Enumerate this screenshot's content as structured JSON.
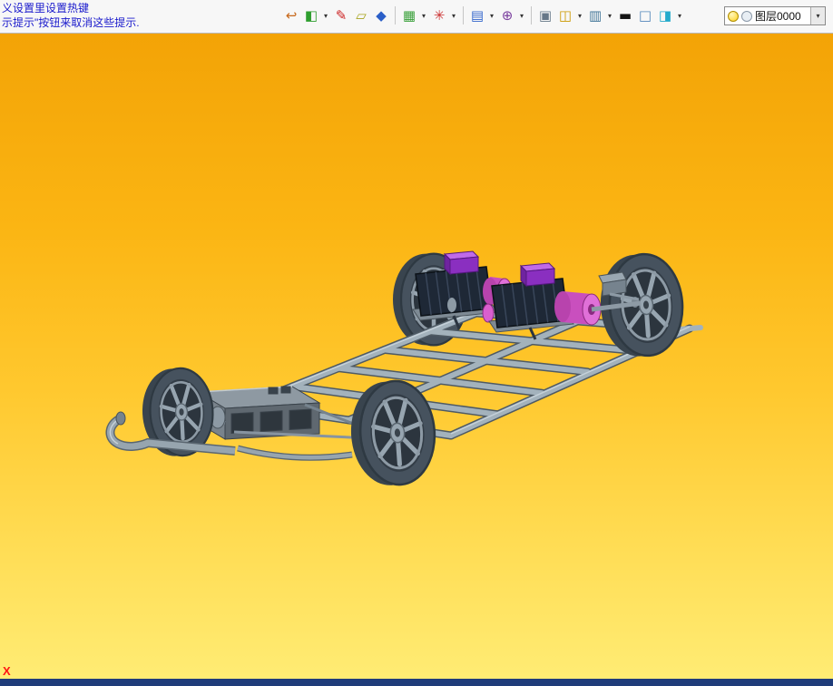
{
  "messages": {
    "line1": "义设置里设置热键",
    "line2": "示提示\"按钮来取消这些提示."
  },
  "toolbar": {
    "dropdown_glyph": "▾",
    "icons": [
      {
        "name": "exit-sketch-icon",
        "glyph": "↩",
        "color": "#C86A1E",
        "dropdown": false
      },
      {
        "name": "fill-style-icon",
        "glyph": "◧",
        "color": "#2E9E2E",
        "dropdown": true
      },
      {
        "name": "sketch-pen-icon",
        "glyph": "✎",
        "color": "#CC2222",
        "dropdown": false
      },
      {
        "name": "plane-sketch-icon",
        "glyph": "▱",
        "color": "#A8A41E",
        "dropdown": false
      },
      {
        "name": "solid-view-icon",
        "glyph": "◆",
        "color": "#2B5FC8",
        "dropdown": false
      },
      {
        "name": "color-grid-icon",
        "glyph": "▦",
        "color": "#3AA03A",
        "dropdown": true
      },
      {
        "name": "wheel-pattern-icon",
        "glyph": "✳",
        "color": "#CC3333",
        "dropdown": true
      },
      {
        "name": "window-view-icon",
        "glyph": "▤",
        "color": "#3366CC",
        "dropdown": true
      },
      {
        "name": "locate-target-icon",
        "glyph": "⊕",
        "color": "#7A3E9E",
        "dropdown": true
      },
      {
        "name": "viewport-pane-icon",
        "glyph": "▣",
        "color": "#667788",
        "dropdown": false
      },
      {
        "name": "frame-layout-icon",
        "glyph": "◫",
        "color": "#CC9900",
        "dropdown": true
      },
      {
        "name": "display-mode-icon",
        "glyph": "▥",
        "color": "#447799",
        "dropdown": true
      },
      {
        "name": "line-width-icon",
        "glyph": "▬",
        "color": "#141414",
        "dropdown": false
      },
      {
        "name": "work-plane-icon",
        "glyph": "□",
        "color": "#5588BB",
        "dropdown": false
      },
      {
        "name": "layer-stack-icon",
        "glyph": "◨",
        "color": "#22AACC",
        "dropdown": true
      }
    ]
  },
  "layer_combo": {
    "value": "图层0000",
    "icons": [
      "bulb-icon",
      "layer-state-icon"
    ]
  },
  "statusbar": {
    "marker": "X"
  },
  "palette": {
    "viewport_gradient_top": "#F3A306",
    "viewport_gradient_bottom": "#FFEC74",
    "statusbar_navy": "#1F3C7A",
    "message_blue": "#1A1ACC",
    "marker_red": "#FF1414",
    "chassis_frame_gray": "#A3B2BC",
    "tire_gray": "#46525E",
    "rim_gray": "#97A5B0",
    "motor_body_dark": "#1E2836",
    "motor_magenta": "#C94FBE",
    "motor_magenta_light": "#E070D8",
    "junction_purple": "#8A2FC0",
    "battery_gray": "#5F6870"
  }
}
